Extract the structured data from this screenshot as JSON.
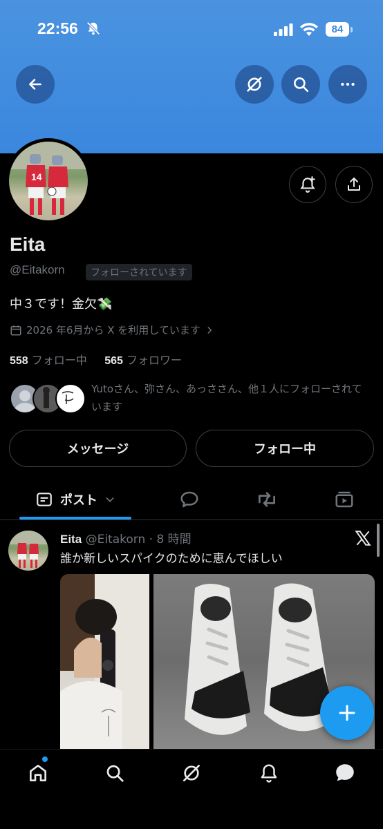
{
  "status_bar": {
    "time": "22:56",
    "battery": "84"
  },
  "profile": {
    "name": "Eita",
    "handle": "@Eitakorn",
    "follows_you": "フォローされています",
    "bio": "中３です！金欠💸",
    "joined": "2026 年6月から X を利用しています",
    "following_count": "558",
    "following_label": "フォロー中",
    "followers_count": "565",
    "followers_label": "フォロワー",
    "followed_by": "Yutoさん、弥さん、あっささん、他１人にフォローされています"
  },
  "actions": {
    "message": "メッセージ",
    "following": "フォロー中"
  },
  "tabs": {
    "posts": "ポスト"
  },
  "post": {
    "name": "Eita",
    "handle": "@Eitakorn",
    "time": "· 8 時間",
    "text": "誰か新しいスパイクのために恵んでほしい"
  },
  "icons": [
    "back-arrow-icon",
    "grok-icon",
    "search-icon",
    "more-icon",
    "notify-icon",
    "share-icon",
    "calendar-icon",
    "chevron-right-icon",
    "post-icon",
    "reply-icon",
    "repost-icon",
    "video-icon",
    "x-logo-icon",
    "plus-icon",
    "home-icon",
    "notifications-icon",
    "messages-icon"
  ],
  "colors": {
    "accent": "#1d9bf0",
    "banner": "#3a87de",
    "secondary_text": "#71767b"
  }
}
